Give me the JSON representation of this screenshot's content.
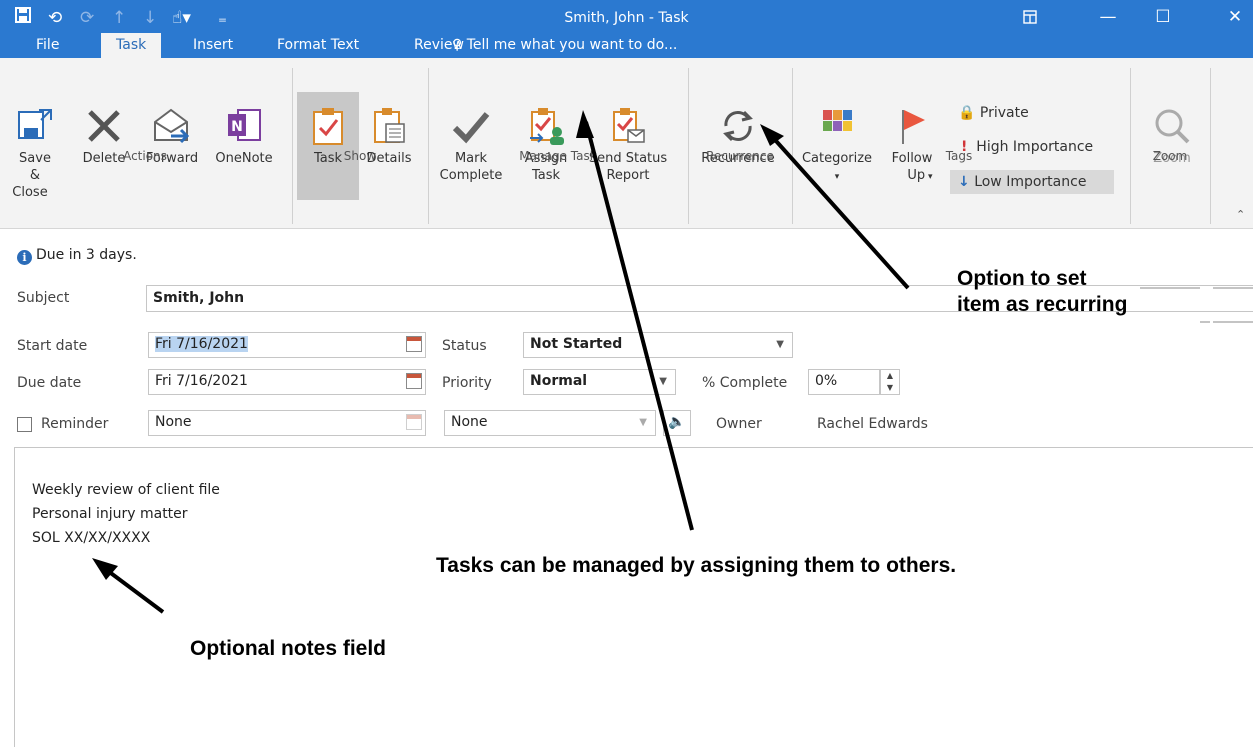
{
  "window": {
    "title": "Smith, John - Task"
  },
  "tabs": [
    {
      "label": "File"
    },
    {
      "label": "Task"
    },
    {
      "label": "Insert"
    },
    {
      "label": "Format Text"
    },
    {
      "label": "Review"
    }
  ],
  "tell_me": "Tell me what you want to do...",
  "ribbon": {
    "actions": {
      "label": "Actions",
      "save_close_1": "Save &",
      "save_close_2": "Close",
      "delete": "Delete",
      "forward": "Forward",
      "onenote": "OneNote"
    },
    "show": {
      "label": "Show",
      "task": "Task",
      "details": "Details"
    },
    "manage": {
      "label": "Manage Task",
      "mark_1": "Mark",
      "mark_2": "Complete",
      "assign_1": "Assign",
      "assign_2": "Task",
      "send_1": "Send Status",
      "send_2": "Report"
    },
    "recurrence": {
      "label": "Recurrence",
      "button": "Recurrence"
    },
    "tags": {
      "label": "Tags",
      "categorize": "Categorize",
      "follow_1": "Follow",
      "follow_2": "Up",
      "private": "Private",
      "high": "High Importance",
      "low": "Low Importance"
    },
    "zoom": {
      "label": "Zoom",
      "button": "Zoom"
    }
  },
  "info_bar": "Due in 3 days.",
  "form": {
    "subject_label": "Subject",
    "subject_value": "Smith, John",
    "start_label": "Start date",
    "start_value": "Fri 7/16/2021",
    "due_label": "Due date",
    "due_value": "Fri 7/16/2021",
    "reminder_label": "Reminder",
    "reminder_date": "None",
    "reminder_time": "None",
    "status_label": "Status",
    "status_value": "Not Started",
    "priority_label": "Priority",
    "priority_value": "Normal",
    "complete_label": "% Complete",
    "complete_value": "0%",
    "owner_label": "Owner",
    "owner_value": "Rachel Edwards"
  },
  "notes": [
    "Weekly review of client file",
    "Personal injury matter",
    "SOL XX/XX/XXXX"
  ],
  "annotations": {
    "recurring_1": "Option to set",
    "recurring_2": "item as recurring",
    "assign": "Tasks can be managed by assigning them to others.",
    "notes": "Optional notes field"
  },
  "colors": {
    "titlebar": "#2b79d0",
    "ribbon": "#f3f3f3"
  }
}
